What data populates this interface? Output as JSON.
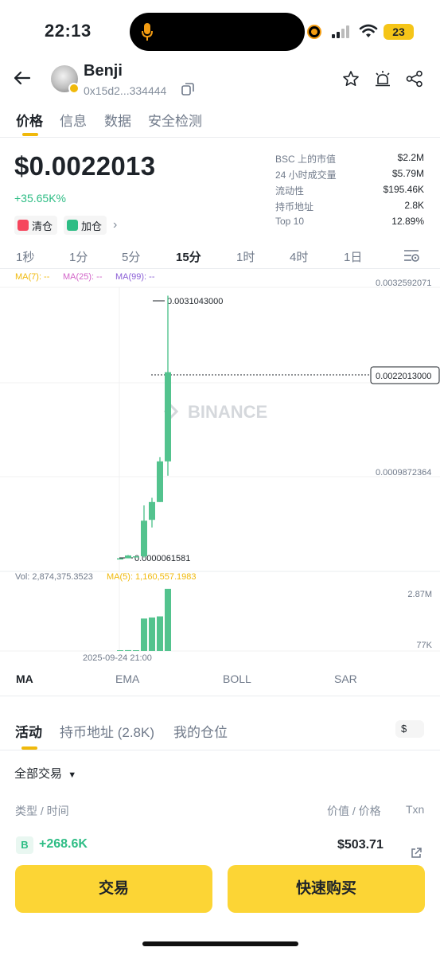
{
  "status": {
    "time": "22:13",
    "battery": "23"
  },
  "header": {
    "token_name": "Benji",
    "address": "0x15d2...334444",
    "icons": [
      "back-arrow-icon",
      "star-icon",
      "alert-icon",
      "share-icon",
      "copy-icon"
    ]
  },
  "tabs": [
    "价格",
    "信息",
    "数据",
    "安全检测"
  ],
  "price": {
    "value": "$0.0022013",
    "change": "+35.65K%",
    "chips": [
      "清仓",
      "加仓"
    ]
  },
  "stats": [
    {
      "label": "BSC 上的市值",
      "value": "$2.2M"
    },
    {
      "label": "24 小时成交量",
      "value": "$5.79M"
    },
    {
      "label": "流动性",
      "value": "$195.46K"
    },
    {
      "label": "持币地址",
      "value": "2.8K"
    },
    {
      "label": "Top 10",
      "value": "12.89%"
    }
  ],
  "intervals": [
    "1秒",
    "1分",
    "5分",
    "15分",
    "1时",
    "4时",
    "1日"
  ],
  "active_interval": "15分",
  "chart": {
    "ma_legend": [
      "MA(7): --",
      "MA(25): --",
      "MA(99): --"
    ],
    "watermark": "BINANCE",
    "price_axis": [
      "0.0032592071",
      "0.0009872364"
    ],
    "current_price_tag": "0.0022013000",
    "high_label": "0.0031043000",
    "low_label": "0.0000061581",
    "vol_legend": "Vol: 2,874,375.3523",
    "vol_ma_legend": "MA(5): 1,160,557.1983",
    "vol_axis": [
      "2.87M",
      "77K"
    ],
    "time_label": "2025-09-24 21:00",
    "colors": {
      "up": "#53c38e",
      "ma7": "#f0b90b",
      "ma25": "#d264c8",
      "ma99": "#8b5fd6"
    }
  },
  "chart_data": {
    "type": "candlestick",
    "candles": [
      {
        "open": 6.2e-06,
        "close": 6.2e-06,
        "high": 6.2e-06,
        "low": 6.2e-06
      },
      {
        "open": 6.2e-06,
        "close": 4e-05,
        "high": 4.5e-05,
        "low": 6.1581e-06
      },
      {
        "open": 3e-05,
        "close": 3e-05,
        "high": 3e-05,
        "low": 3e-05
      },
      {
        "open": 3e-05,
        "close": 0.00045,
        "high": 0.00063,
        "low": 1.5e-05
      },
      {
        "open": 0.00046,
        "close": 0.00067,
        "high": 0.00072,
        "low": 0.00037
      },
      {
        "open": 0.00067,
        "close": 0.00115,
        "high": 0.0012,
        "low": 0.00067
      },
      {
        "open": 0.00115,
        "close": 0.0022013,
        "high": 0.0031043,
        "low": 0.00098
      }
    ],
    "volume": [
      0,
      40000,
      10000,
      1500000,
      1550000,
      1600000,
      2874375.3523
    ],
    "y_axis_range": [
      6.1581e-06,
      0.0032592071
    ],
    "volume_range": [
      0,
      2870000
    ]
  },
  "indicators": [
    "MA",
    "EMA",
    "BOLL",
    "SAR"
  ],
  "activity": {
    "tabs": [
      "活动",
      "持币地址 (2.8K)",
      "我的仓位"
    ],
    "currency": "$",
    "filter": "全部交易",
    "col_left": "类型 / 时间",
    "col_mid": "价值 / 价格",
    "col_right": "Txn",
    "row": {
      "type": "B",
      "amount": "+268.6K",
      "value": "$503.71"
    }
  },
  "buttons": {
    "trade": "交易",
    "quick_buy": "快速购买"
  }
}
